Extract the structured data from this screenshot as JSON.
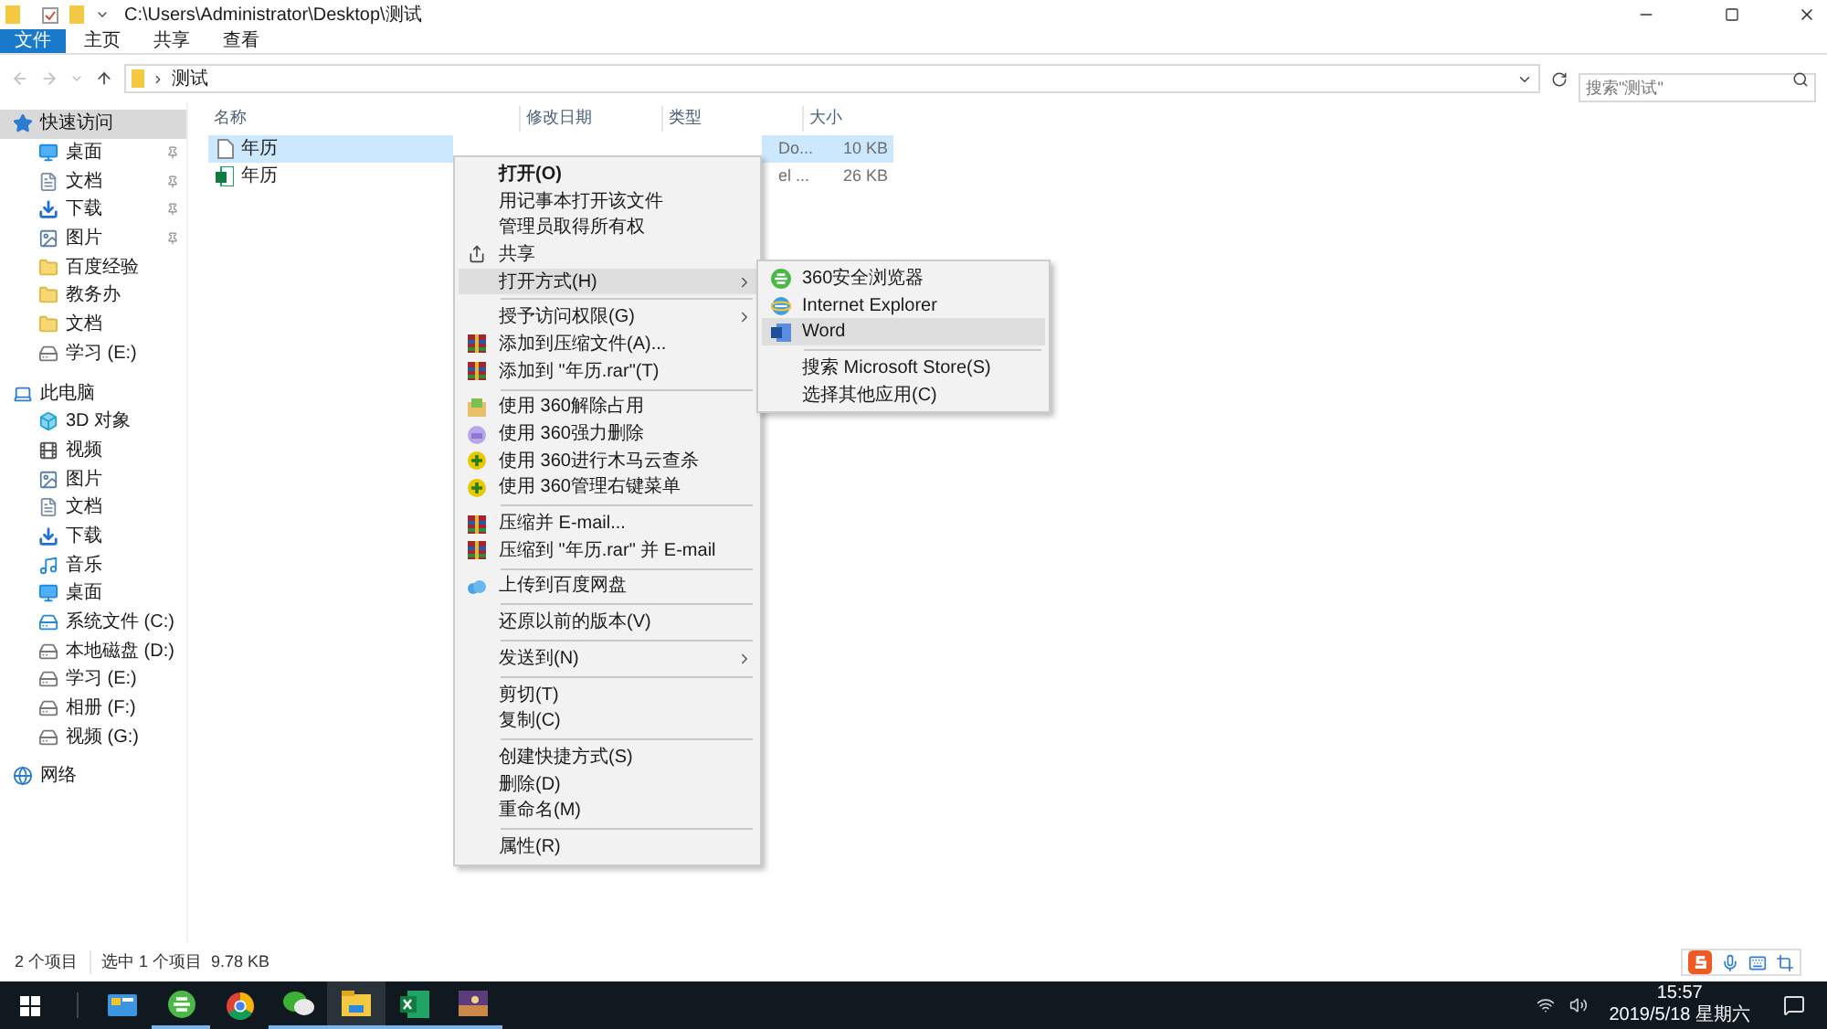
{
  "window": {
    "path": "C:\\Users\\Administrator\\Desktop\\测试"
  },
  "ribbon_tabs": [
    {
      "label": "文件",
      "selected": true
    },
    {
      "label": "主页",
      "selected": false
    },
    {
      "label": "共享",
      "selected": false
    },
    {
      "label": "查看",
      "selected": false
    }
  ],
  "address": {
    "crumb": "测试",
    "search_placeholder": "搜索\"测试\""
  },
  "sidebar": [
    {
      "label": "快速访问",
      "kind": "star",
      "selected": true,
      "children": [
        {
          "label": "桌面",
          "kind": "desktop",
          "pinned": true
        },
        {
          "label": "文档",
          "kind": "doc",
          "pinned": true
        },
        {
          "label": "下载",
          "kind": "download",
          "pinned": true
        },
        {
          "label": "图片",
          "kind": "picture",
          "pinned": true
        },
        {
          "label": "百度经验",
          "kind": "folder"
        },
        {
          "label": "教务办",
          "kind": "folder"
        },
        {
          "label": "文档",
          "kind": "folder"
        },
        {
          "label": "学习 (E:)",
          "kind": "drive"
        }
      ]
    },
    {
      "label": "此电脑",
      "kind": "pc",
      "selected": false,
      "children": [
        {
          "label": "3D 对象",
          "kind": "cube"
        },
        {
          "label": "视频",
          "kind": "video"
        },
        {
          "label": "图片",
          "kind": "picture"
        },
        {
          "label": "文档",
          "kind": "doc"
        },
        {
          "label": "下载",
          "kind": "download"
        },
        {
          "label": "音乐",
          "kind": "music"
        },
        {
          "label": "桌面",
          "kind": "desktop"
        },
        {
          "label": "系统文件 (C:)",
          "kind": "sysdrive"
        },
        {
          "label": "本地磁盘 (D:)",
          "kind": "drive"
        },
        {
          "label": "学习 (E:)",
          "kind": "drive"
        },
        {
          "label": "相册 (F:)",
          "kind": "drive"
        },
        {
          "label": "视频 (G:)",
          "kind": "drive"
        }
      ]
    },
    {
      "label": "网络",
      "kind": "network",
      "selected": false
    }
  ],
  "columns": [
    "名称",
    "修改日期",
    "类型",
    "大小"
  ],
  "files": [
    {
      "name": "年历",
      "kind": "html",
      "type": "Do...",
      "size": "10 KB",
      "selected": true
    },
    {
      "name": "年历",
      "kind": "excel",
      "type": "el ...",
      "size": "26 KB",
      "selected": false
    }
  ],
  "context_menu": [
    {
      "kind": "plain",
      "label": "打开(O)",
      "bold": true
    },
    {
      "kind": "plain",
      "label": "用记事本打开该文件"
    },
    {
      "kind": "plain",
      "label": "管理员取得所有权"
    },
    {
      "kind": "share",
      "label": "共享"
    },
    {
      "kind": "plain",
      "label": "打开方式(H)",
      "submenu": true,
      "selected": true
    },
    {
      "kind": "separator"
    },
    {
      "kind": "plain",
      "label": "授予访问权限(G)",
      "submenu": true
    },
    {
      "kind": "rar",
      "label": "添加到压缩文件(A)..."
    },
    {
      "kind": "rar",
      "label": "添加到 \"年历.rar\"(T)"
    },
    {
      "kind": "separator"
    },
    {
      "kind": "unlock",
      "label": "使用 360解除占用"
    },
    {
      "kind": "shred",
      "label": "使用 360强力删除"
    },
    {
      "kind": "scan",
      "label": "使用 360进行木马云查杀"
    },
    {
      "kind": "scan",
      "label": "使用 360管理右键菜单"
    },
    {
      "kind": "separator"
    },
    {
      "kind": "rar",
      "label": "压缩并 E-mail..."
    },
    {
      "kind": "rar",
      "label": "压缩到 \"年历.rar\" 并 E-mail"
    },
    {
      "kind": "separator"
    },
    {
      "kind": "cloud",
      "label": "上传到百度网盘"
    },
    {
      "kind": "separator"
    },
    {
      "kind": "plain",
      "label": "还原以前的版本(V)"
    },
    {
      "kind": "separator"
    },
    {
      "kind": "plain",
      "label": "发送到(N)",
      "submenu": true
    },
    {
      "kind": "separator"
    },
    {
      "kind": "plain",
      "label": "剪切(T)"
    },
    {
      "kind": "plain",
      "label": "复制(C)"
    },
    {
      "kind": "separator"
    },
    {
      "kind": "plain",
      "label": "创建快捷方式(S)"
    },
    {
      "kind": "plain",
      "label": "删除(D)"
    },
    {
      "kind": "plain",
      "label": "重命名(M)"
    },
    {
      "kind": "separator"
    },
    {
      "kind": "plain",
      "label": "属性(R)"
    }
  ],
  "submenu": [
    {
      "kind": "browser360",
      "label": "360安全浏览器",
      "selected": false
    },
    {
      "kind": "ie",
      "label": "Internet Explorer",
      "selected": false
    },
    {
      "kind": "word",
      "label": "Word",
      "selected": true
    },
    {
      "kind": "separator"
    },
    {
      "kind": "plain",
      "label": "搜索 Microsoft Store(S)",
      "selected": false
    },
    {
      "kind": "plain",
      "label": "选择其他应用(C)",
      "selected": false
    }
  ],
  "status_bar": {
    "count": "2 个项目",
    "selection": "选中 1 个项目  9.78 KB"
  },
  "taskbar": {
    "apps": [
      {
        "kind": "panel",
        "open": false
      },
      {
        "kind": "browser360",
        "open": true
      },
      {
        "kind": "chrome",
        "open": false
      },
      {
        "kind": "wechat",
        "open": true
      },
      {
        "kind": "explorer",
        "open": true,
        "selected": true
      },
      {
        "kind": "excel",
        "open": true
      },
      {
        "kind": "photo",
        "open": true
      }
    ],
    "time": "15:57",
    "date": "2019/5/18 星期六"
  }
}
